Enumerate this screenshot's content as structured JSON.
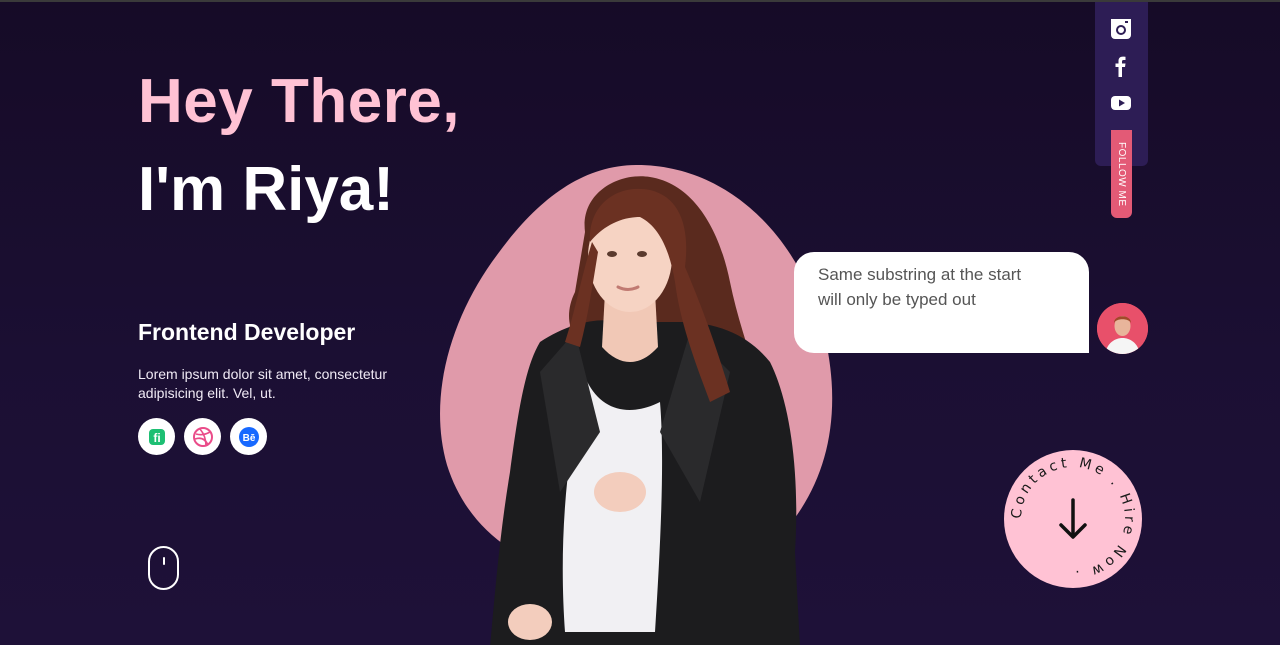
{
  "hero": {
    "line1": "Hey There,",
    "line2": "I'm Riya!"
  },
  "profile": {
    "role": "Frontend Developer",
    "description": "Lorem ipsum dolor sit amet, consectetur adipisicing elit. Vel, ut."
  },
  "social_links": [
    {
      "icon": "fiverr-icon",
      "label": "fi"
    },
    {
      "icon": "dribbble-icon"
    },
    {
      "icon": "behance-icon",
      "label": "Bē"
    }
  ],
  "chat": {
    "message_line1": "Same substring at the start",
    "message_line2": "will only be typed out"
  },
  "follow": {
    "label": "FOLLOW ME",
    "icons": [
      "instagram-icon",
      "facebook-icon",
      "youtube-icon"
    ]
  },
  "hire": {
    "circular_text": "Contact Me . Hire Now .",
    "icon": "arrow-down-icon"
  },
  "colors": {
    "background": "#1a0d2e",
    "accent_pink": "#ffc2d4",
    "blob_pink": "#e09aaa",
    "follow_bar": "#2d1d55",
    "follow_tag": "#e35a76"
  }
}
